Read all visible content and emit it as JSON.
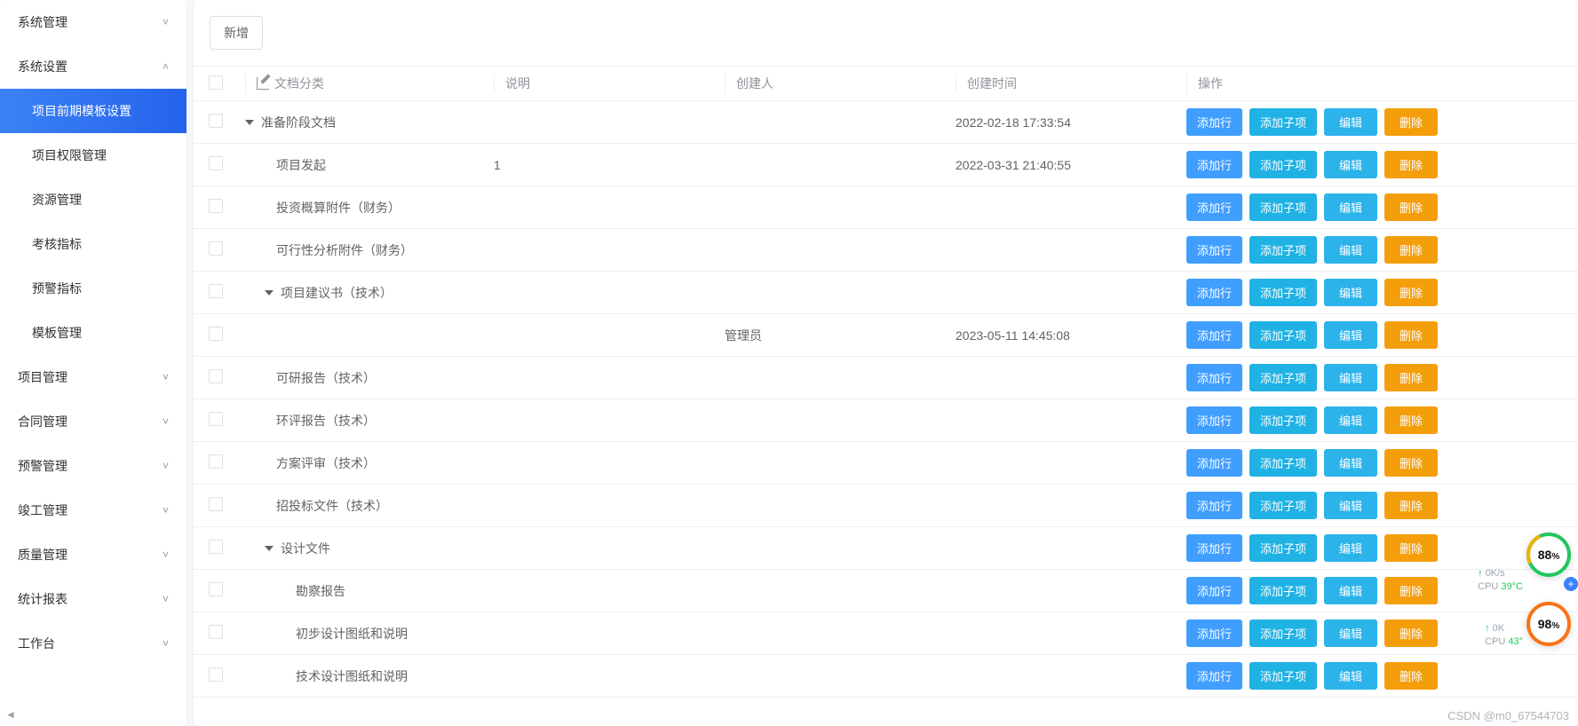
{
  "sidebar": {
    "groups": [
      {
        "label": "系统管理",
        "expanded": false,
        "items": []
      },
      {
        "label": "系统设置",
        "expanded": true,
        "items": [
          {
            "label": "项目前期模板设置",
            "active": true
          },
          {
            "label": "项目权限管理",
            "active": false
          },
          {
            "label": "资源管理",
            "active": false
          },
          {
            "label": "考核指标",
            "active": false
          },
          {
            "label": "预警指标",
            "active": false
          },
          {
            "label": "模板管理",
            "active": false
          }
        ]
      },
      {
        "label": "项目管理",
        "expanded": false,
        "items": []
      },
      {
        "label": "合同管理",
        "expanded": false,
        "items": []
      },
      {
        "label": "预警管理",
        "expanded": false,
        "items": []
      },
      {
        "label": "竣工管理",
        "expanded": false,
        "items": []
      },
      {
        "label": "质量管理",
        "expanded": false,
        "items": []
      },
      {
        "label": "统计报表",
        "expanded": false,
        "items": []
      },
      {
        "label": "工作台",
        "expanded": false,
        "items": []
      }
    ]
  },
  "toolbar": {
    "add_label": "新增"
  },
  "table": {
    "columns": {
      "name": "文档分类",
      "desc": "说明",
      "creator": "创建人",
      "time": "创建时间",
      "ops": "操作"
    },
    "actions": {
      "add_row": "添加行",
      "add_child": "添加子项",
      "edit": "编辑",
      "delete": "删除"
    },
    "rows": [
      {
        "indent": 0,
        "caret": true,
        "name": "准备阶段文档",
        "desc": "",
        "creator": "",
        "time": "2022-02-18 17:33:54"
      },
      {
        "indent": 1,
        "caret": false,
        "name": "项目发起",
        "desc": "1",
        "creator": "",
        "time": "2022-03-31 21:40:55"
      },
      {
        "indent": 1,
        "caret": false,
        "name": "投资概算附件（财务）",
        "desc": "",
        "creator": "",
        "time": ""
      },
      {
        "indent": 1,
        "caret": false,
        "name": "可行性分析附件（财务）",
        "desc": "",
        "creator": "",
        "time": ""
      },
      {
        "indent": 1,
        "caret": true,
        "name": "项目建议书（技术）",
        "desc": "",
        "creator": "",
        "time": ""
      },
      {
        "indent": 2,
        "caret": false,
        "name": "",
        "desc": "",
        "creator": "管理员",
        "time": "2023-05-11 14:45:08"
      },
      {
        "indent": 1,
        "caret": false,
        "name": "可研报告（技术）",
        "desc": "",
        "creator": "",
        "time": ""
      },
      {
        "indent": 1,
        "caret": false,
        "name": "环评报告（技术）",
        "desc": "",
        "creator": "",
        "time": ""
      },
      {
        "indent": 1,
        "caret": false,
        "name": "方案评审（技术）",
        "desc": "",
        "creator": "",
        "time": ""
      },
      {
        "indent": 1,
        "caret": false,
        "name": "招投标文件（技术）",
        "desc": "",
        "creator": "",
        "time": ""
      },
      {
        "indent": 1,
        "caret": true,
        "name": "设计文件",
        "desc": "",
        "creator": "",
        "time": ""
      },
      {
        "indent": 2,
        "caret": false,
        "name": "勘察报告",
        "desc": "",
        "creator": "",
        "time": ""
      },
      {
        "indent": 2,
        "caret": false,
        "name": "初步设计图纸和说明",
        "desc": "",
        "creator": "",
        "time": ""
      },
      {
        "indent": 2,
        "caret": false,
        "name": "技术设计图纸和说明",
        "desc": "",
        "creator": "",
        "time": ""
      }
    ]
  },
  "overlay": {
    "ring1": "88",
    "ring1_unit": "%",
    "ring2": "98",
    "ring2_unit": "%",
    "net_up": "↑",
    "net_rate": "0K/s",
    "cpu1_label": "CPU",
    "cpu1_val": "39°C",
    "net2_rate": "0K",
    "cpu2_label": "CPU",
    "cpu2_val": "43°"
  },
  "watermark": "CSDN @m0_67544703"
}
